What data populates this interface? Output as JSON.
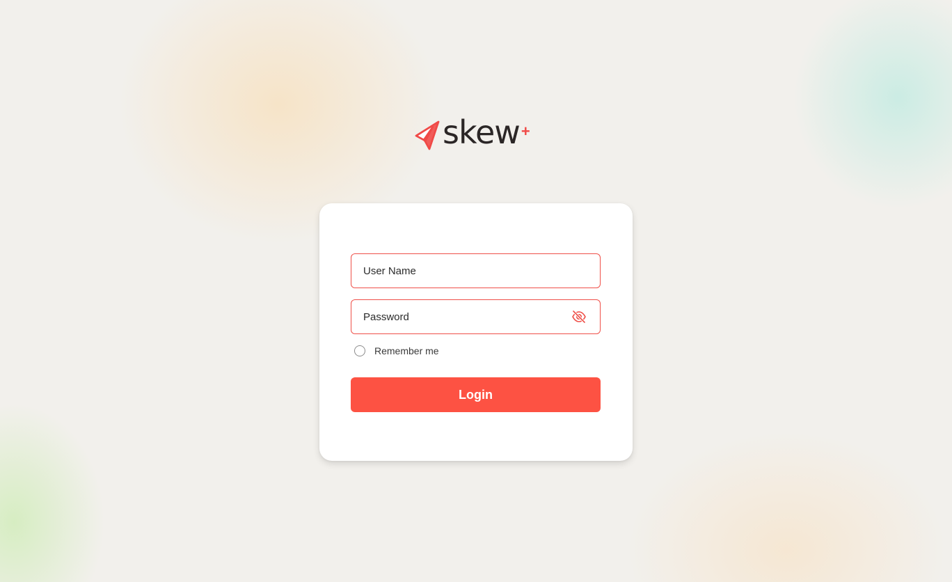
{
  "logo": {
    "wordmark": "skew",
    "plus": "+",
    "icon": "paper-plane-icon",
    "brand_color": "#f04a47"
  },
  "form": {
    "username": {
      "placeholder": "User Name",
      "value": ""
    },
    "password": {
      "placeholder": "Password",
      "value": "",
      "toggle_icon": "eye-off-icon"
    },
    "remember": {
      "label": "Remember me",
      "checked": false
    },
    "login_label": "Login"
  },
  "colors": {
    "accent": "#fd5243",
    "field_border": "#ef4f48",
    "card_background": "#ffffff",
    "page_background": "#f2f0ec"
  }
}
